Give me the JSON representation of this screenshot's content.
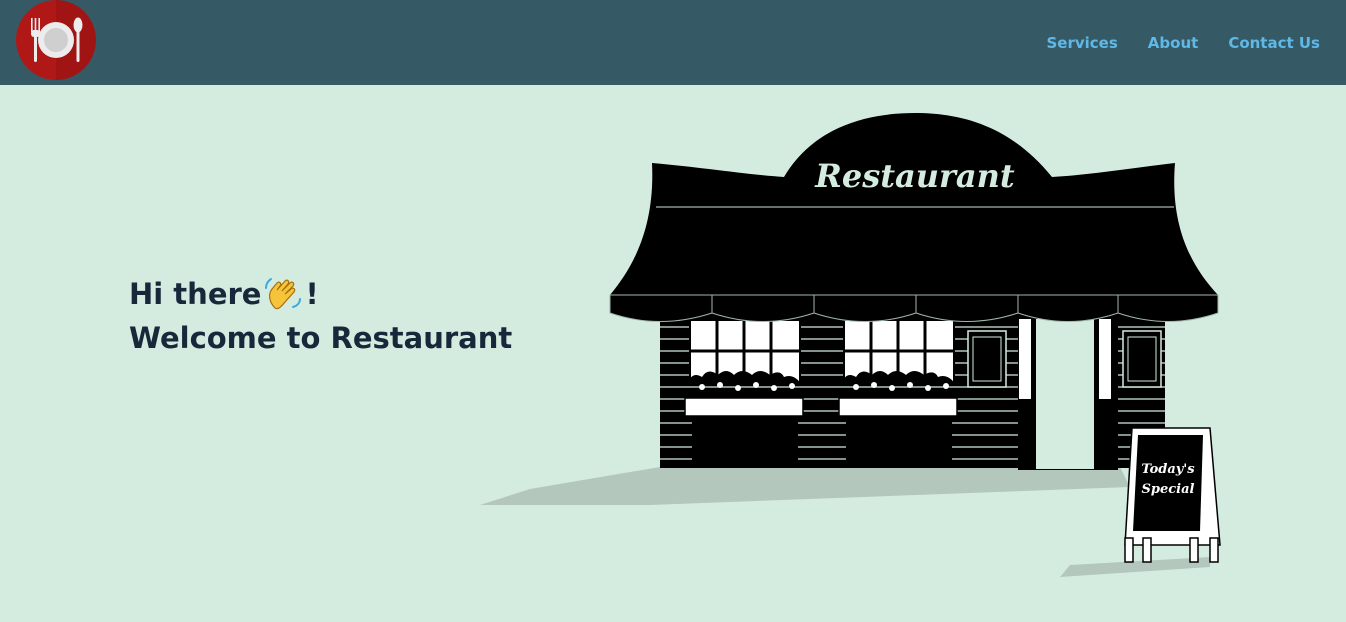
{
  "header": {
    "logo_icon": "plate-fork-spoon-icon",
    "nav": [
      {
        "label": "Services"
      },
      {
        "label": "About"
      },
      {
        "label": "Contact Us"
      }
    ]
  },
  "hero": {
    "greeting_prefix": "Hi there",
    "greeting_icon": "waving-hand-icon",
    "greeting_suffix": "!",
    "welcome": "Welcome to Restaurant"
  },
  "illustration": {
    "sign": "Restaurant",
    "board_line1": "Today's",
    "board_line2": "Special"
  },
  "colors": {
    "background": "#d4ecdf",
    "navbar": "#355a66",
    "nav_link": "#5fb8e6",
    "logo": "#b01818",
    "heading": "#17283a"
  }
}
